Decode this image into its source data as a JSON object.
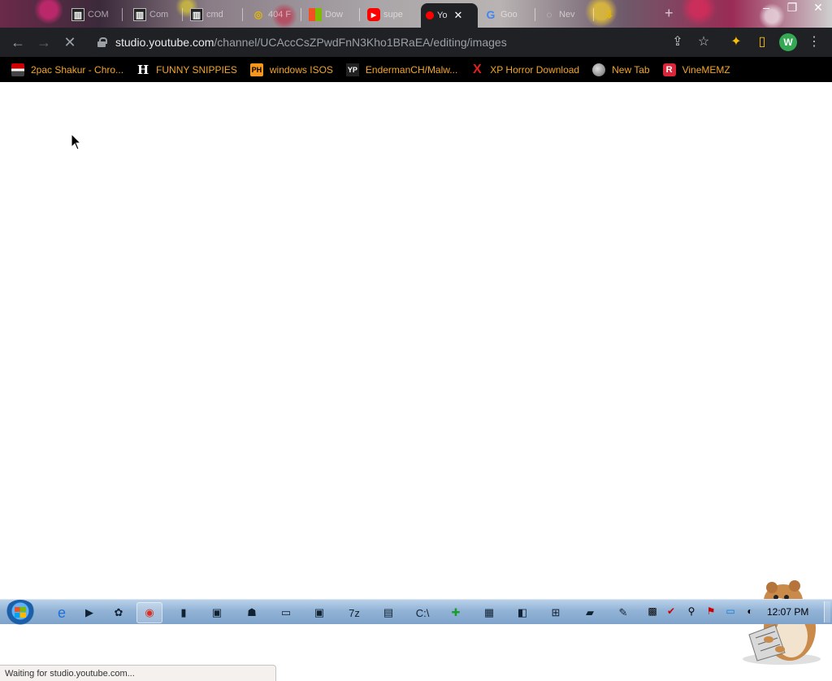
{
  "window": {
    "tabs": [
      {
        "title": "COM",
        "icon": "archive-icon"
      },
      {
        "title": "Com",
        "icon": "archive-icon"
      },
      {
        "title": "cmd",
        "icon": "archive-icon"
      },
      {
        "title": "404 F",
        "icon": "gold-icon"
      },
      {
        "title": "Dow",
        "icon": "microsoft-icon"
      },
      {
        "title": "supe",
        "icon": "youtube-icon"
      },
      {
        "title": "Yo",
        "icon": "youtube-studio-icon",
        "active": true
      },
      {
        "title": "Goo",
        "icon": "google-icon"
      },
      {
        "title": "Nev",
        "icon": "globe-icon"
      },
      {
        "title": "",
        "icon": "download-icon"
      }
    ],
    "new_tab_symbol": "+",
    "controls": {
      "minimize": "–",
      "restore": "❐",
      "close": "✕"
    }
  },
  "toolbar": {
    "back_symbol": "←",
    "forward_symbol": "→",
    "stop_symbol": "✕",
    "url_host": "studio.youtube.com",
    "url_path": "/channel/UCAccCsZPwdFnN3Kho1BRaEA/editing/images",
    "share_symbol": "⇪",
    "star_symbol": "☆",
    "extensions_symbol": "✦",
    "sidepanel_symbol": "▯",
    "profile_initial": "W",
    "menu_symbol": "⋮"
  },
  "bookmarks": [
    {
      "label": "2pac Shakur - Chro...",
      "icon": "pac-icon"
    },
    {
      "label": "FUNNY SNIPPIES",
      "icon": "h-icon",
      "glyph": "H"
    },
    {
      "label": "windows ISOS",
      "icon": "ph-icon",
      "glyph": "PH"
    },
    {
      "label": "EndermanCH/Malw...",
      "icon": "yp-icon",
      "glyph": "YP"
    },
    {
      "label": "XP Horror Download",
      "icon": "x-icon",
      "glyph": "X"
    },
    {
      "label": "New Tab",
      "icon": "globe-icon"
    },
    {
      "label": "VineMEMZ",
      "icon": "r-icon",
      "glyph": "R"
    }
  ],
  "status": {
    "text": "Waiting for studio.youtube.com..."
  },
  "taskbar": {
    "clock": "12:07 PM",
    "apps": [
      {
        "name": "internet-explorer-icon",
        "glyph": "e"
      },
      {
        "name": "media-player-icon",
        "glyph": "▶"
      },
      {
        "name": "firefox-like-icon",
        "glyph": "✿"
      },
      {
        "name": "chrome-icon",
        "glyph": "◉"
      },
      {
        "name": "app-icon-1",
        "glyph": "▮"
      },
      {
        "name": "app-icon-2",
        "glyph": "▣"
      },
      {
        "name": "app-icon-3",
        "glyph": "☗"
      },
      {
        "name": "app-icon-4",
        "glyph": "▭"
      },
      {
        "name": "app-icon-5",
        "glyph": "▣"
      },
      {
        "name": "7zip-icon",
        "glyph": "7z"
      },
      {
        "name": "notepad-icon",
        "glyph": "▤"
      },
      {
        "name": "cmd-icon",
        "glyph": "C:\\"
      },
      {
        "name": "green-app-icon",
        "glyph": "✚"
      },
      {
        "name": "clipboard-icon",
        "glyph": "▦"
      },
      {
        "name": "window-app-icon",
        "glyph": "◧"
      },
      {
        "name": "network-icon",
        "glyph": "⊞"
      },
      {
        "name": "folder-icon",
        "glyph": "▰"
      },
      {
        "name": "paint-icon",
        "glyph": "✎"
      }
    ],
    "tray": [
      {
        "name": "tray-icon-1",
        "glyph": "▩"
      },
      {
        "name": "tray-check-icon",
        "glyph": "✔"
      },
      {
        "name": "tray-search-icon",
        "glyph": "⚲"
      },
      {
        "name": "flag-icon",
        "glyph": "⚑"
      },
      {
        "name": "monitor-icon",
        "glyph": "▭"
      },
      {
        "name": "volume-icon",
        "glyph": "◐"
      }
    ]
  },
  "colors": {
    "bookmark_text": "#f2a62a",
    "toolbar_bg": "#202124",
    "profile": "#34a853"
  }
}
